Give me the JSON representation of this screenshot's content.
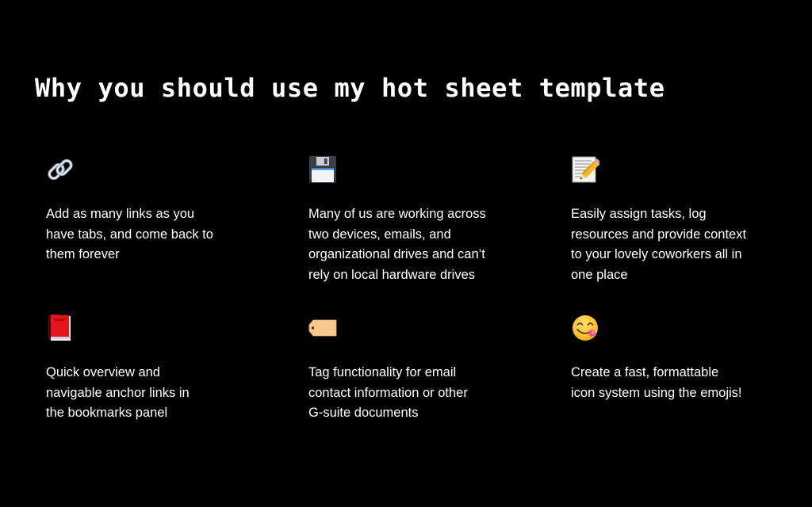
{
  "page": {
    "title": "Why you should use my hot sheet template",
    "background_color": "#000000",
    "text_color": "#ffffff"
  },
  "features": [
    {
      "icon": "link-icon",
      "emoji": "🔗",
      "text": "Add as many links as you\nhave tabs, and come back to\nthem forever"
    },
    {
      "icon": "floppy-disk-icon",
      "emoji": "💾",
      "text": "Many of us are working across\ntwo devices, emails, and\norganizational drives and can’t\nrely on local hardware drives"
    },
    {
      "icon": "memo-icon",
      "emoji": "📝",
      "text": "Easily assign tasks, log\nresources and provide context\nto your lovely coworkers all in\none place"
    },
    {
      "icon": "red-book-icon",
      "emoji": "📕",
      "text": "Quick overview and\nnavigable anchor links in\nthe bookmarks panel"
    },
    {
      "icon": "label-tag-icon",
      "emoji": "🏷",
      "text": "Tag functionality for email\ncontact information or other\nG-suite documents"
    },
    {
      "icon": "yum-face-icon",
      "emoji": "😋",
      "text": "Create a fast, formattable\nicon system using the emojis!"
    }
  ]
}
